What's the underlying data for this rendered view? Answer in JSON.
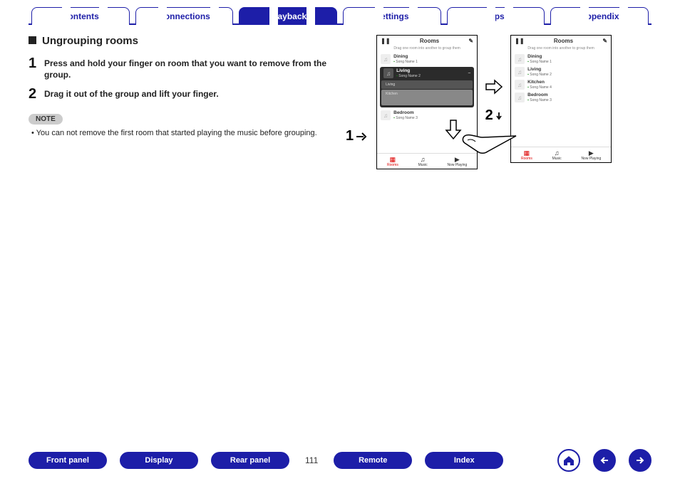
{
  "tabs": [
    "Contents",
    "Connections",
    "Playback",
    "Settings",
    "Tips",
    "Appendix"
  ],
  "activeTab": 2,
  "heading": "Ungrouping rooms",
  "steps": [
    {
      "n": "1",
      "t": "Press and hold your finger on room that you want to remove from the group."
    },
    {
      "n": "2",
      "t": "Drag it out of the group and lift your finger."
    }
  ],
  "noteBadge": "NOTE",
  "noteText": "You can not remove the first room that started playing the music before grouping.",
  "callout1": "1",
  "callout2": "2",
  "phone": {
    "title": "Rooms",
    "hint": "Drag one room into another to group them",
    "rooms": {
      "dining": {
        "name": "Dining",
        "song": "Song Name 1"
      },
      "living": {
        "name": "Living",
        "song": "Song Name 2"
      },
      "livingSub": "Living",
      "kitchenSub": "Kitchen",
      "kitchen": {
        "name": "Kitchen",
        "song": "Song Name 4"
      },
      "bedroom": {
        "name": "Bedroom",
        "song": "Song Name 3"
      }
    },
    "tabs": {
      "rooms": "Rooms",
      "music": "Music",
      "now": "Now Playing"
    }
  },
  "bottom": {
    "front": "Front panel",
    "display": "Display",
    "rear": "Rear panel",
    "remote": "Remote",
    "index": "Index",
    "page": "111"
  }
}
